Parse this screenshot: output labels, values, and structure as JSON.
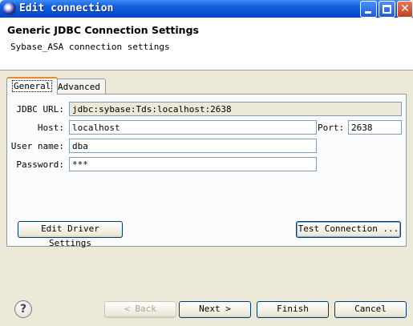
{
  "window": {
    "title": "Edit connection",
    "min_icon": "minimize-icon",
    "max_icon": "maximize-icon",
    "close_icon": "close-icon",
    "close_glyph": "✕"
  },
  "header": {
    "title": "Generic JDBC Connection Settings",
    "subtitle": "Sybase_ASA connection settings"
  },
  "tabs": [
    {
      "label": "General",
      "active": true
    },
    {
      "label": "Advanced",
      "active": false
    }
  ],
  "form": {
    "jdbc_url_label": "JDBC URL:",
    "jdbc_url_value": "jdbc:sybase:Tds:localhost:2638",
    "host_label": "Host:",
    "host_value": "localhost",
    "port_label": "Port:",
    "port_value": "2638",
    "user_label": "User name:",
    "user_value": "dba",
    "password_label": "Password:",
    "password_value": "***"
  },
  "buttons": {
    "edit_driver": "Edit Driver Settings",
    "test_connection": "Test Connection ...",
    "back": "< Back",
    "next": "Next >",
    "finish": "Finish",
    "cancel": "Cancel",
    "help_glyph": "?"
  }
}
